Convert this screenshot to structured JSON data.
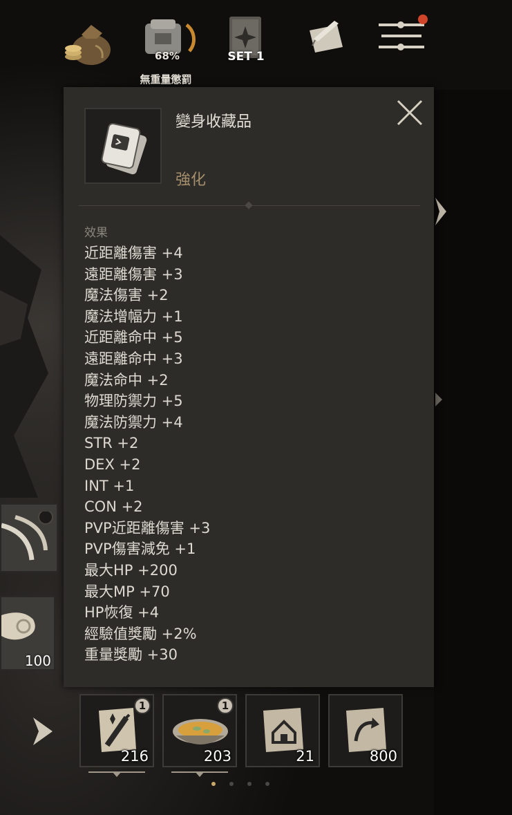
{
  "top_bar": {
    "bag_icon": "coin-bag-icon",
    "weight_percent": "68%",
    "weight_label": "無重量懲罰",
    "weight_fraction": 0.68,
    "set_label": "SET 1",
    "quest_icon": "scroll-quill-icon",
    "menu_icon": "menu-icon"
  },
  "tooltip": {
    "item_name": "變身收藏品",
    "item_subtitle": "強化",
    "section_label": "效果",
    "effects": [
      "近距離傷害 +4",
      "遠距離傷害 +3",
      "魔法傷害 +2",
      "魔法增幅力 +1",
      "近距離命中 +5",
      "遠距離命中 +3",
      "魔法命中 +2",
      "物理防禦力 +5",
      "魔法防禦力 +4",
      "STR +2",
      "DEX +2",
      "INT +1",
      "CON +2",
      "PVP近距離傷害 +3",
      "PVP傷害減免 +1",
      "最大HP +200",
      "最大MP +70",
      "HP恢復 +4",
      "經驗值獎勵 +2%",
      "重量獎勵 +30"
    ]
  },
  "side_slots": {
    "skill_icon": "claw-skill-icon",
    "scroll_count": "100"
  },
  "quick_slots": [
    {
      "icon": "enchant-weapon-scroll-icon",
      "count": "216",
      "badge": "1"
    },
    {
      "icon": "soup-bowl-icon",
      "count": "203",
      "badge": "1"
    },
    {
      "icon": "home-scroll-icon",
      "count": "21",
      "badge": ""
    },
    {
      "icon": "return-scroll-icon",
      "count": "800",
      "badge": ""
    }
  ],
  "pager": {
    "pages": 4,
    "active": 0
  },
  "colors": {
    "panel": "#2d2c29",
    "accent_gold": "#c9a86a",
    "subtitle": "#a58f6c"
  }
}
